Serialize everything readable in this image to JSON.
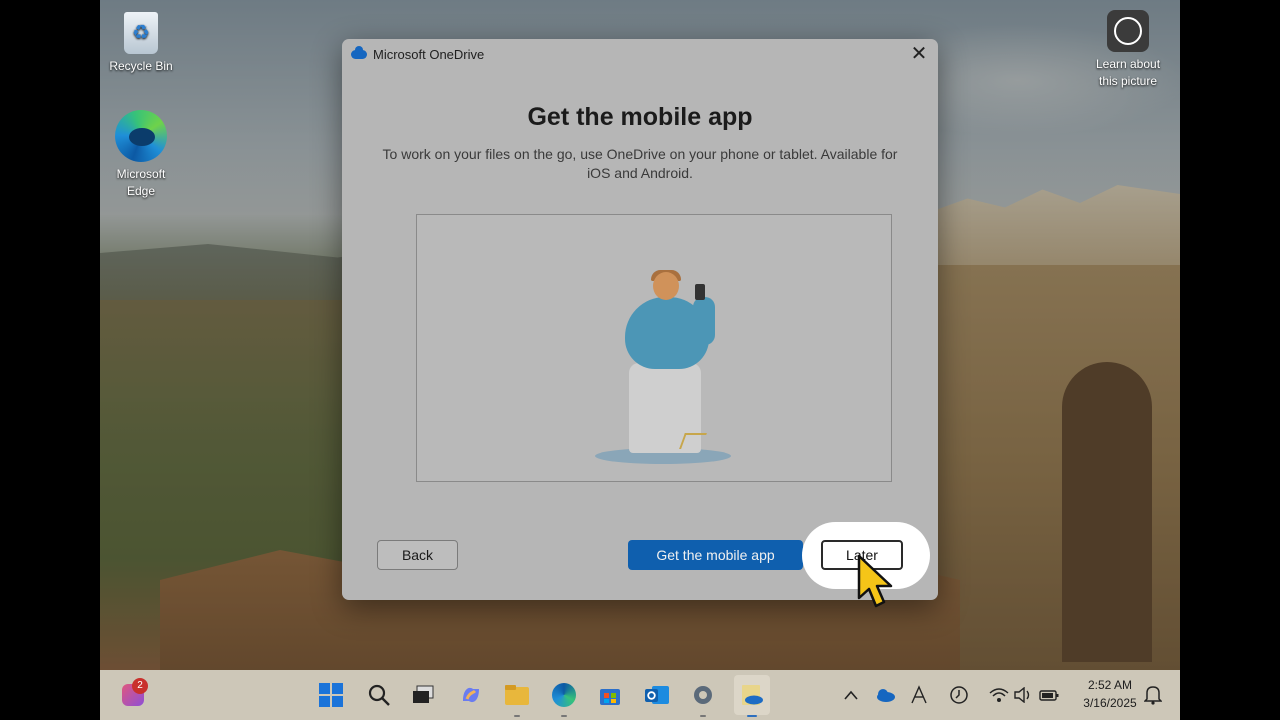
{
  "desktop": {
    "icons": [
      {
        "label": "Recycle Bin",
        "icon": "recycle-bin-icon"
      },
      {
        "label": "Microsoft Edge",
        "icon": "edge-icon"
      },
      {
        "label": "Learn about this picture",
        "icon": "learn-about-picture-icon"
      }
    ]
  },
  "dialog": {
    "app_title": "Microsoft OneDrive",
    "close_glyph": "✕",
    "heading": "Get the mobile app",
    "subtext": "To work on your files on the go, use OneDrive on your phone or tablet. Available for iOS and Android.",
    "back_label": "Back",
    "primary_label": "Get the mobile app",
    "later_label": "Later"
  },
  "taskbar": {
    "copilot_badge": "2",
    "pinned": [
      "start-icon",
      "search-icon",
      "task-view-icon",
      "copilot-icon",
      "file-explorer-icon",
      "edge-icon",
      "store-icon",
      "outlook-icon",
      "settings-icon",
      "onedrive-icon"
    ],
    "tray": {
      "time": "2:52 AM",
      "date": "3/16/2025"
    }
  },
  "colors": {
    "primary_button": "#0f5fae",
    "highlight": "#ffffff",
    "cursor_fill": "#f5c518"
  }
}
